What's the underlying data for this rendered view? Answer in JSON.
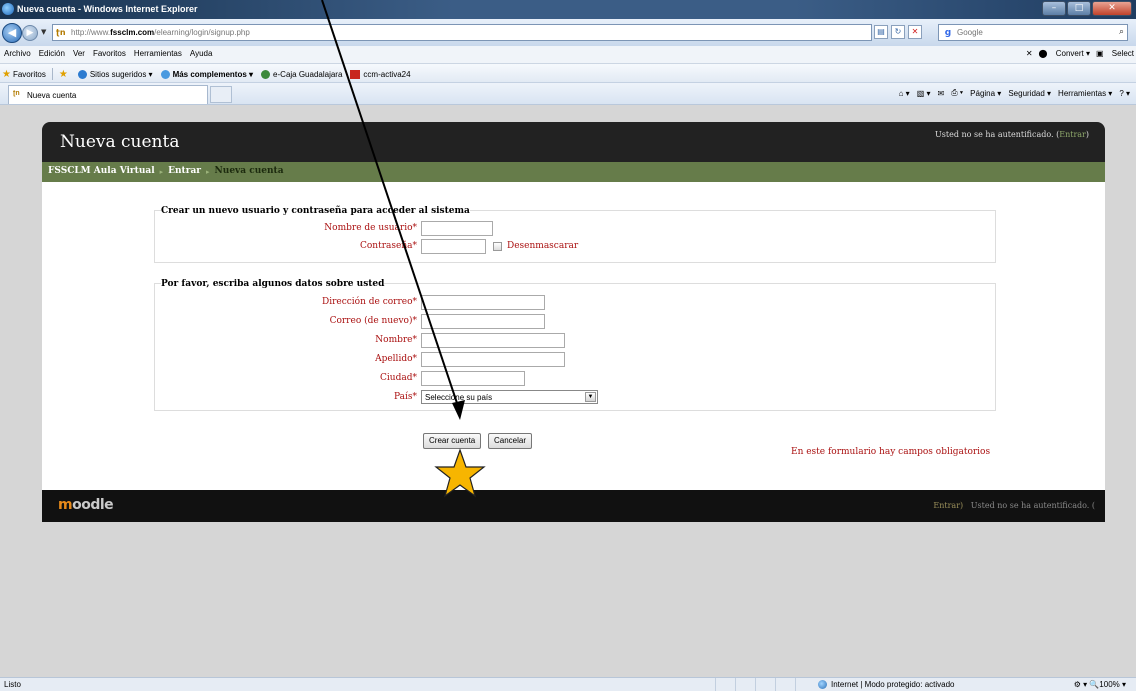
{
  "window": {
    "title": "Nueva cuenta - Windows Internet Explorer",
    "min": "–",
    "max": "□",
    "close": "✕"
  },
  "address": {
    "url_prefix": "http://www.",
    "url_host": "fssclm.com",
    "url_path": "/elearning/login/signup.php",
    "search_placeholder": "Google"
  },
  "menu": {
    "items": [
      "Archivo",
      "Edición",
      "Ver",
      "Favoritos",
      "Herramientas",
      "Ayuda"
    ],
    "convert": "Convert",
    "select": "Select"
  },
  "favorites": {
    "label": "Favoritos",
    "items": [
      "Sitios sugeridos ▾",
      "Más complementos ▾",
      "e-Caja Guadalajara",
      "ccm-activa24"
    ]
  },
  "tabs": {
    "active": "Nueva cuenta"
  },
  "commandbar": {
    "pagina": "Página ▾",
    "seguridad": "Seguridad ▾",
    "herramientas": "Herramientas ▾"
  },
  "page": {
    "title": "Nueva cuenta",
    "login_info_prefix": "Usted no se ha autentificado. (",
    "login_link": "Entrar",
    "login_info_suffix": ")",
    "breadcrumb": [
      "FSSCLM Aula Virtual",
      "Entrar",
      "Nueva cuenta"
    ],
    "section1": {
      "legend": "Crear un nuevo usuario y contraseña para acceder al sistema",
      "username_label": "Nombre de usuario",
      "password_label": "Contraseña",
      "unmask_label": "Desenmascarar"
    },
    "section2": {
      "legend": "Por favor, escriba algunos datos sobre usted",
      "email_label": "Dirección de correo",
      "email2_label": "Correo (de nuevo)",
      "firstname_label": "Nombre",
      "lastname_label": "Apellido",
      "city_label": "Ciudad",
      "country_label": "País",
      "country_value": "Seleccione su país"
    },
    "required_mark": "*",
    "create_button": "Crear cuenta",
    "cancel_button": "Cancelar",
    "required_note": "En este formulario hay campos obligatorios",
    "footer_logo_m": "m",
    "footer_logo_rest": "oodle",
    "footer_login_link": "Entrar)",
    "footer_login_info": "Usted no se ha autentificado. ("
  },
  "statusbar": {
    "status": "Listo",
    "zone": "Internet | Modo protegido: activado",
    "zoom": "⚙ ▾  🔍100%  ▾"
  },
  "colors": {
    "header_bg": "#222222",
    "nav_bg": "#667c4a",
    "label_red": "#aa1111",
    "star_fill": "#f7b500"
  }
}
